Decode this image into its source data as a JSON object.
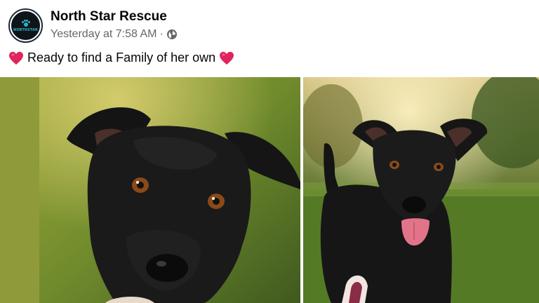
{
  "post": {
    "page_name": "North Star Rescue",
    "timestamp": "Yesterday at 7:58 AM",
    "separator": "·",
    "caption": "Ready to find a Family of her own",
    "avatar_text": "NORTHSTAR"
  },
  "icons": {
    "globe": "globe-icon",
    "heart": "heart-icon"
  },
  "colors": {
    "heart": "#e0245e",
    "meta_text": "#65676b",
    "brand_teal": "#2ab3c7"
  }
}
